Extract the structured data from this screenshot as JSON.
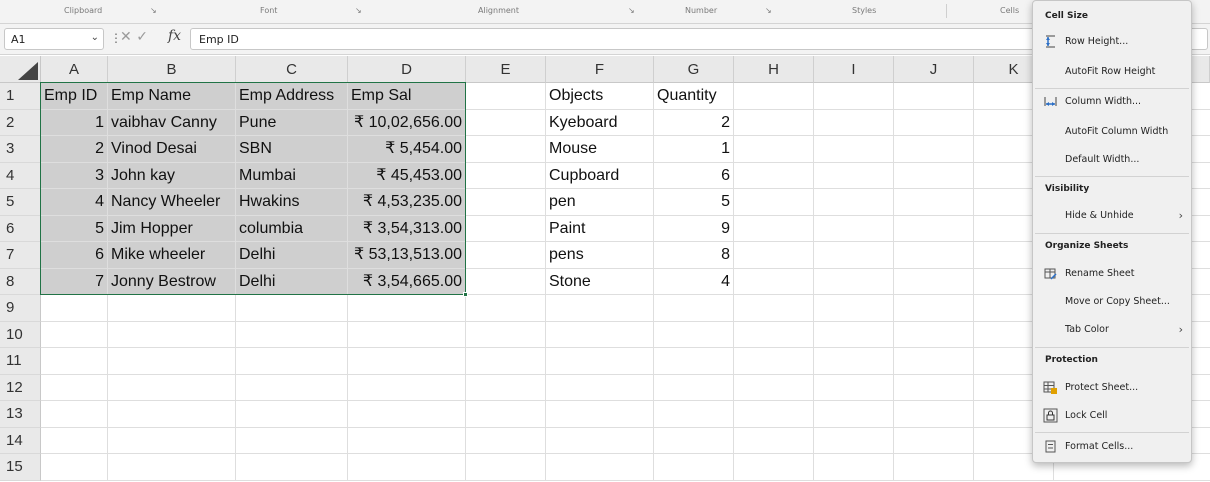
{
  "ribbon": {
    "groups": [
      "Clipboard",
      "Font",
      "Alignment",
      "Number",
      "Styles",
      "Cells"
    ]
  },
  "formula_bar": {
    "name_box": "A1",
    "formula": "Emp ID"
  },
  "columns": [
    "A",
    "B",
    "C",
    "D",
    "E",
    "F",
    "G",
    "H",
    "I",
    "J",
    "K"
  ],
  "rows": [
    "1",
    "2",
    "3",
    "4",
    "5",
    "6",
    "7",
    "8",
    "9",
    "10",
    "11",
    "12",
    "13",
    "14",
    "15"
  ],
  "employee_table": {
    "headers": [
      "Emp ID",
      "Emp Name",
      "Emp Address",
      "Emp Sal"
    ],
    "rows": [
      [
        "1",
        "vaibhav Canny",
        "Pune",
        "₹ 10,02,656.00"
      ],
      [
        "2",
        "Vinod Desai",
        "SBN",
        "₹ 5,454.00"
      ],
      [
        "3",
        "John kay",
        "Mumbai",
        "₹ 45,453.00"
      ],
      [
        "4",
        "Nancy Wheeler",
        "Hwakins",
        "₹ 4,53,235.00"
      ],
      [
        "5",
        "Jim Hopper",
        "columbia",
        "₹ 3,54,313.00"
      ],
      [
        "6",
        "Mike wheeler",
        "Delhi",
        "₹ 53,13,513.00"
      ],
      [
        "7",
        "Jonny  Bestrow",
        "Delhi",
        "₹ 3,54,665.00"
      ]
    ]
  },
  "objects_table": {
    "headers": [
      "Objects",
      "Quantity"
    ],
    "rows": [
      [
        "Kyeboard",
        "2"
      ],
      [
        "Mouse",
        "1"
      ],
      [
        "Cupboard",
        "6"
      ],
      [
        "pen",
        "5"
      ],
      [
        "Paint",
        "9"
      ],
      [
        "pens",
        "8"
      ],
      [
        "Stone",
        "4"
      ]
    ]
  },
  "context_menu": {
    "cell_size": {
      "heading": "Cell Size",
      "row_height": "Row Height...",
      "autofit_row_height": "AutoFit Row Height",
      "column_width": "Column Width...",
      "autofit_column_width": "AutoFit Column Width",
      "default_width": "Default Width..."
    },
    "visibility": {
      "heading": "Visibility",
      "hide_unhide": "Hide & Unhide"
    },
    "organize": {
      "heading": "Organize Sheets",
      "rename_sheet": "Rename Sheet",
      "move_copy_sheet": "Move or Copy Sheet...",
      "tab_color": "Tab Color"
    },
    "protection": {
      "heading": "Protection",
      "protect_sheet": "Protect Sheet...",
      "lock_cell": "Lock Cell",
      "format_cells": "Format Cells..."
    }
  },
  "colors": {
    "selection_border": "#217346",
    "selection_fill": "#cfcfcf",
    "header_bg": "#e9e9e9"
  }
}
